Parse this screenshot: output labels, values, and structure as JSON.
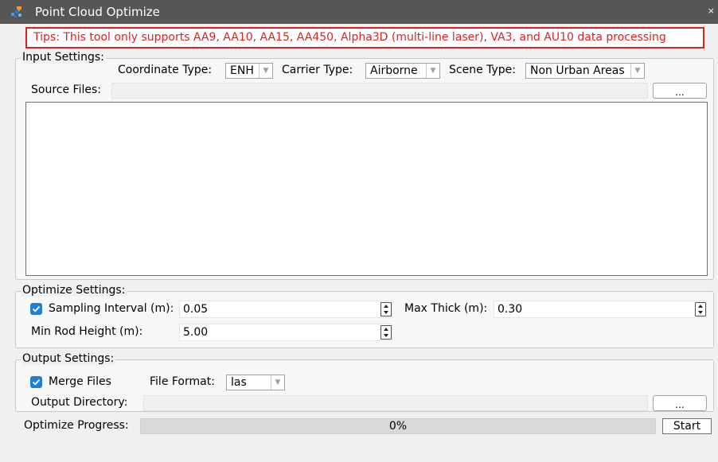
{
  "window": {
    "title": "Point Cloud Optimize",
    "close_glyph": "×",
    "app_icon": "point-cloud-app-icon"
  },
  "tips": "Tips: This tool only supports AA9, AA10, AA15, AA450, Alpha3D (multi-line laser), VA3, and AU10 data processing",
  "input_settings": {
    "title": "Input Settings:",
    "coordinate_type": {
      "label": "Coordinate Type:",
      "value": "ENH"
    },
    "carrier_type": {
      "label": "Carrier Type:",
      "value": "Airborne"
    },
    "scene_type": {
      "label": "Scene Type:",
      "value": "Non Urban Areas"
    },
    "source_files": {
      "label": "Source Files:",
      "value": "",
      "browse_label": "..."
    }
  },
  "optimize_settings": {
    "title": "Optimize Settings:",
    "sampling_interval": {
      "label": "Sampling Interval (m):",
      "value": "0.05",
      "checked": true
    },
    "max_thick": {
      "label": "Max Thick (m):",
      "value": "0.30"
    },
    "min_rod_height": {
      "label": "Min Rod Height (m):",
      "value": "5.00"
    }
  },
  "output_settings": {
    "title": "Output Settings:",
    "merge_files": {
      "label": "Merge Files",
      "checked": true
    },
    "file_format": {
      "label": "File Format:",
      "value": "las"
    },
    "output_directory": {
      "label": "Output Directory:",
      "value": "",
      "browse_label": "..."
    }
  },
  "progress": {
    "label": "Optimize Progress:",
    "text": "0%",
    "value_percent": 0,
    "start_label": "Start"
  },
  "colors": {
    "accent": "#1e7fd6",
    "tip_red": "#e02020",
    "titlebar": "#565656"
  }
}
